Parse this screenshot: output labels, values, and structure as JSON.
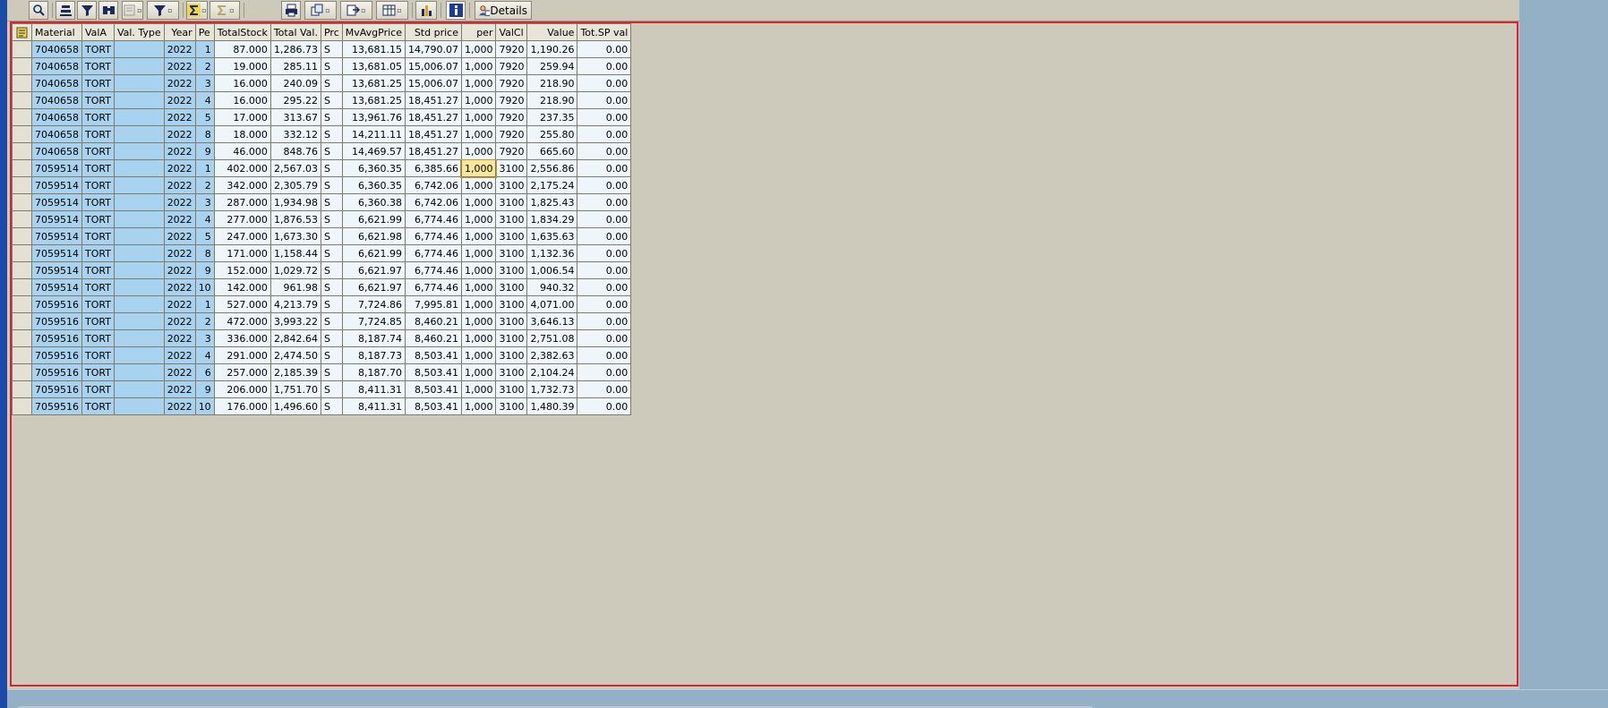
{
  "toolbar": {
    "buttons": [
      {
        "icon": "find-icon"
      },
      {
        "icon": "sort-ascending-icon"
      },
      {
        "icon": "filter-icon"
      },
      {
        "icon": "find-next-icon"
      },
      {
        "icon": "print-preview-icon"
      },
      {
        "icon": "set-filter-icon"
      },
      {
        "icon": "total-icon"
      },
      {
        "icon": "subtotal-icon"
      },
      {
        "icon": "print-icon"
      },
      {
        "icon": "views-icon"
      },
      {
        "icon": "export-icon"
      },
      {
        "icon": "layout-icon"
      },
      {
        "icon": "graphic-icon"
      },
      {
        "icon": "info-icon"
      }
    ],
    "details_label": "Details"
  },
  "table": {
    "columns": [
      "Material",
      "ValA",
      "Val. Type",
      "Year",
      "Pe",
      "TotalStock",
      "Total Val.",
      "Prc",
      "MvAvgPrice",
      "Std price",
      "per",
      "ValCl",
      "Value",
      "Tot.SP val"
    ],
    "rows": [
      [
        "7040658",
        "TORT",
        "",
        "2022",
        "1",
        "87.000",
        "1,286.73",
        "S",
        "13,681.15",
        "14,790.07",
        "1,000",
        "7920",
        "1,190.26",
        "0.00"
      ],
      [
        "7040658",
        "TORT",
        "",
        "2022",
        "2",
        "19.000",
        "285.11",
        "S",
        "13,681.05",
        "15,006.07",
        "1,000",
        "7920",
        "259.94",
        "0.00"
      ],
      [
        "7040658",
        "TORT",
        "",
        "2022",
        "3",
        "16.000",
        "240.09",
        "S",
        "13,681.25",
        "15,006.07",
        "1,000",
        "7920",
        "218.90",
        "0.00"
      ],
      [
        "7040658",
        "TORT",
        "",
        "2022",
        "4",
        "16.000",
        "295.22",
        "S",
        "13,681.25",
        "18,451.27",
        "1,000",
        "7920",
        "218.90",
        "0.00"
      ],
      [
        "7040658",
        "TORT",
        "",
        "2022",
        "5",
        "17.000",
        "313.67",
        "S",
        "13,961.76",
        "18,451.27",
        "1,000",
        "7920",
        "237.35",
        "0.00"
      ],
      [
        "7040658",
        "TORT",
        "",
        "2022",
        "8",
        "18.000",
        "332.12",
        "S",
        "14,211.11",
        "18,451.27",
        "1,000",
        "7920",
        "255.80",
        "0.00"
      ],
      [
        "7040658",
        "TORT",
        "",
        "2022",
        "9",
        "46.000",
        "848.76",
        "S",
        "14,469.57",
        "18,451.27",
        "1,000",
        "7920",
        "665.60",
        "0.00"
      ],
      [
        "7059514",
        "TORT",
        "",
        "2022",
        "1",
        "402.000",
        "2,567.03",
        "S",
        "6,360.35",
        "6,385.66",
        "1,000",
        "3100",
        "2,556.86",
        "0.00"
      ],
      [
        "7059514",
        "TORT",
        "",
        "2022",
        "2",
        "342.000",
        "2,305.79",
        "S",
        "6,360.35",
        "6,742.06",
        "1,000",
        "3100",
        "2,175.24",
        "0.00"
      ],
      [
        "7059514",
        "TORT",
        "",
        "2022",
        "3",
        "287.000",
        "1,934.98",
        "S",
        "6,360.38",
        "6,742.06",
        "1,000",
        "3100",
        "1,825.43",
        "0.00"
      ],
      [
        "7059514",
        "TORT",
        "",
        "2022",
        "4",
        "277.000",
        "1,876.53",
        "S",
        "6,621.99",
        "6,774.46",
        "1,000",
        "3100",
        "1,834.29",
        "0.00"
      ],
      [
        "7059514",
        "TORT",
        "",
        "2022",
        "5",
        "247.000",
        "1,673.30",
        "S",
        "6,621.98",
        "6,774.46",
        "1,000",
        "3100",
        "1,635.63",
        "0.00"
      ],
      [
        "7059514",
        "TORT",
        "",
        "2022",
        "8",
        "171.000",
        "1,158.44",
        "S",
        "6,621.99",
        "6,774.46",
        "1,000",
        "3100",
        "1,132.36",
        "0.00"
      ],
      [
        "7059514",
        "TORT",
        "",
        "2022",
        "9",
        "152.000",
        "1,029.72",
        "S",
        "6,621.97",
        "6,774.46",
        "1,000",
        "3100",
        "1,006.54",
        "0.00"
      ],
      [
        "7059514",
        "TORT",
        "",
        "2022",
        "10",
        "142.000",
        "961.98",
        "S",
        "6,621.97",
        "6,774.46",
        "1,000",
        "3100",
        "940.32",
        "0.00"
      ],
      [
        "7059516",
        "TORT",
        "",
        "2022",
        "1",
        "527.000",
        "4,213.79",
        "S",
        "7,724.86",
        "7,995.81",
        "1,000",
        "3100",
        "4,071.00",
        "0.00"
      ],
      [
        "7059516",
        "TORT",
        "",
        "2022",
        "2",
        "472.000",
        "3,993.22",
        "S",
        "7,724.85",
        "8,460.21",
        "1,000",
        "3100",
        "3,646.13",
        "0.00"
      ],
      [
        "7059516",
        "TORT",
        "",
        "2022",
        "3",
        "336.000",
        "2,842.64",
        "S",
        "8,187.74",
        "8,460.21",
        "1,000",
        "3100",
        "2,751.08",
        "0.00"
      ],
      [
        "7059516",
        "TORT",
        "",
        "2022",
        "4",
        "291.000",
        "2,474.50",
        "S",
        "8,187.73",
        "8,503.41",
        "1,000",
        "3100",
        "2,382.63",
        "0.00"
      ],
      [
        "7059516",
        "TORT",
        "",
        "2022",
        "6",
        "257.000",
        "2,185.39",
        "S",
        "8,187.70",
        "8,503.41",
        "1,000",
        "3100",
        "2,104.24",
        "0.00"
      ],
      [
        "7059516",
        "TORT",
        "",
        "2022",
        "9",
        "206.000",
        "1,751.70",
        "S",
        "8,411.31",
        "8,503.41",
        "1,000",
        "3100",
        "1,732.73",
        "0.00"
      ],
      [
        "7059516",
        "TORT",
        "",
        "2022",
        "10",
        "176.000",
        "1,496.60",
        "S",
        "8,411.31",
        "8,503.41",
        "1,000",
        "3100",
        "1,480.39",
        "0.00"
      ]
    ],
    "highlighted_cell": {
      "row": 7,
      "col": 10
    }
  },
  "colors": {
    "key_cell": "#a9d2ef",
    "value_cell": "#eef6fb",
    "highlight": "#fbe69a",
    "frame": "#e0202a"
  }
}
